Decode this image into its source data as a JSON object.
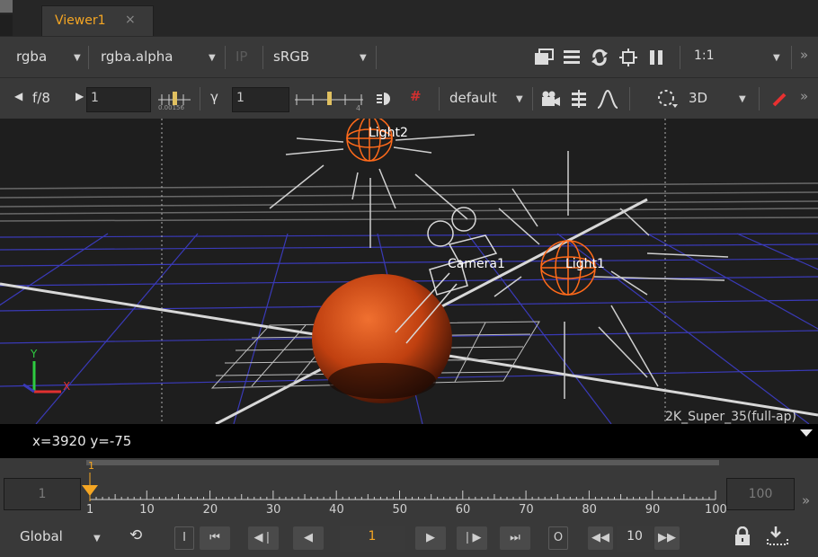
{
  "tab": {
    "title": "Viewer1",
    "close": "×"
  },
  "toolbar1": {
    "channels": "rgba",
    "alpha_channel": "rgba.alpha",
    "ip_label": "IP",
    "colorspace": "sRGB",
    "zoom": "1:1"
  },
  "toolbar2": {
    "fstop": "f/8",
    "frame_field": "1",
    "gain_ticks": "0.00156",
    "gamma_label": "γ",
    "gamma_field": "1",
    "gamma_ticks": "4",
    "lut": "default",
    "view_mode": "3D"
  },
  "viewport": {
    "labels": {
      "light2": "Light2",
      "light1": "Light1",
      "camera1": "Camera1",
      "format": "2K_Super_35(full-ap)",
      "axis_y": "Y",
      "axis_x": "X"
    }
  },
  "status": {
    "coords": "x=3920 y=-75"
  },
  "timeline": {
    "in_frame": "1",
    "out_frame": "100",
    "current_marker": "1",
    "ticks": [
      "1",
      "10",
      "20",
      "30",
      "40",
      "50",
      "60",
      "70",
      "80",
      "90",
      "100"
    ],
    "scope": "Global",
    "current_frame": "1",
    "step": "10",
    "i_label": "I",
    "o_label": "O"
  },
  "colors": {
    "accent": "#f5a623",
    "sphere": "#e0501a",
    "grid": "#3a3ab8"
  }
}
